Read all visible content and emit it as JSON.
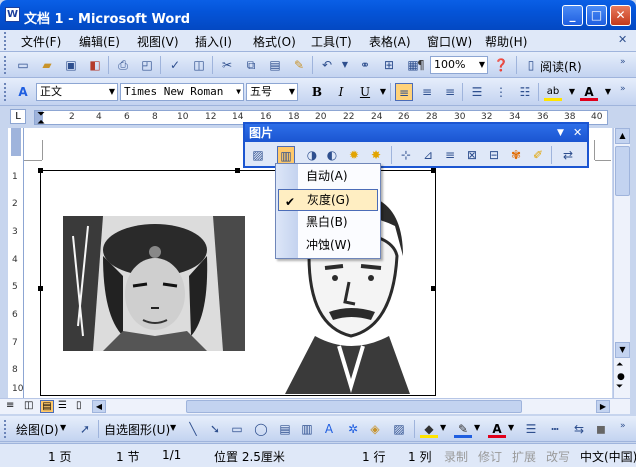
{
  "window": {
    "title": "文档 1 - Microsoft Word",
    "app_icon": "W",
    "minimize": "_",
    "maximize": "□",
    "close": "✕"
  },
  "menubar": [
    "文件(F)",
    "编辑(E)",
    "视图(V)",
    "插入(I)",
    "格式(O)",
    "工具(T)",
    "表格(A)",
    "窗口(W)",
    "帮助(H)"
  ],
  "standard_toolbar": {
    "zoom": "100%",
    "read_label": "阅读(R)"
  },
  "format_toolbar": {
    "style": "正文",
    "font": "Times New Roman",
    "size": "五号",
    "bold": "B",
    "italic": "I",
    "underline": "U",
    "font_color": "A"
  },
  "ruler": {
    "numbers": [
      "2",
      "4",
      "6",
      "8",
      "10",
      "12",
      "14",
      "16",
      "18",
      "20",
      "22",
      "24",
      "26",
      "28",
      "30",
      "32",
      "34",
      "36",
      "38",
      "40"
    ]
  },
  "vruler": {
    "numbers": [
      "1",
      "2",
      "3",
      "4",
      "5",
      "6",
      "7",
      "8",
      "9",
      "10"
    ]
  },
  "picture_toolbar": {
    "title": "图片"
  },
  "color_menu": {
    "items": [
      "自动(A)",
      "灰度(G)",
      "黑白(B)",
      "冲蚀(W)"
    ],
    "selected_index": 1
  },
  "drawing_toolbar": {
    "draw_label": "绘图(D)",
    "autoshapes_label": "自选图形(U)"
  },
  "statusbar": {
    "page": "1 页",
    "section": "1 节",
    "page_of": "1/1",
    "position": "位置 2.5厘米",
    "line": "1 行",
    "column": "1 列",
    "rec": "录制",
    "trk": "修订",
    "ext": "扩展",
    "ovr": "改写",
    "language": "中文(中国)"
  },
  "colors": {
    "title_bar": "#0454d8",
    "bar_bg": "#dfe8f8",
    "menu_highlight": "#ffeec2"
  }
}
